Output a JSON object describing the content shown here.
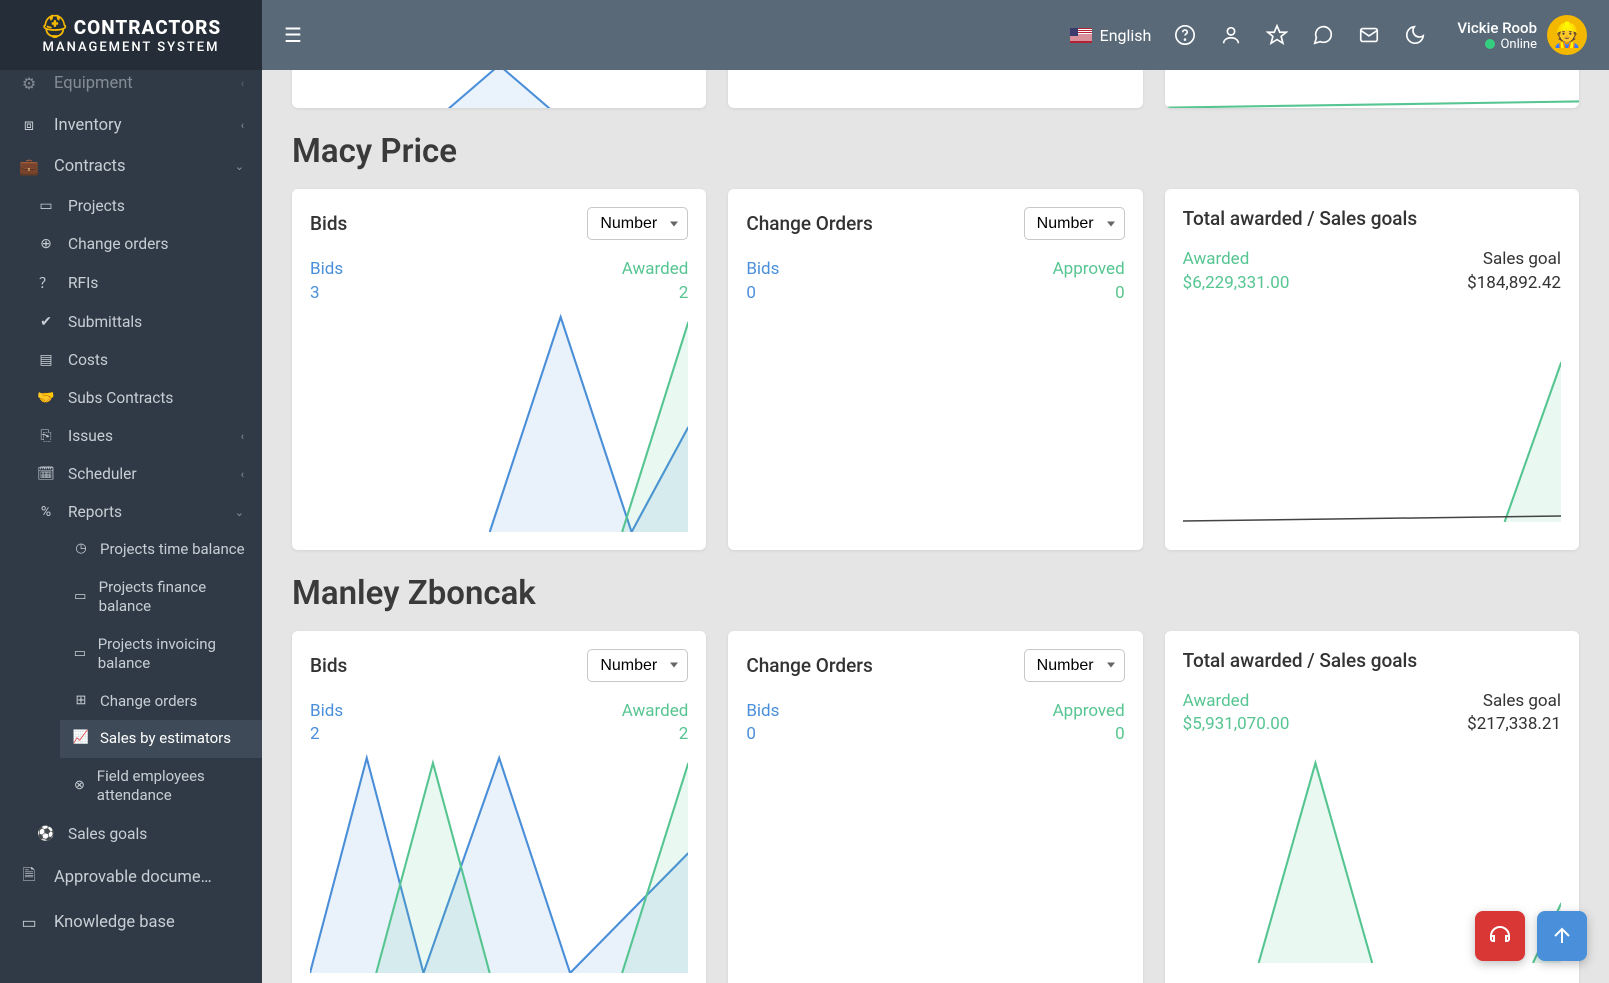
{
  "logo": {
    "top": "CONTRACTORS",
    "sub": "MANAGEMENT SYSTEM"
  },
  "header": {
    "language": "English",
    "user_name": "Vickie Roob",
    "user_status": "Online"
  },
  "sidebar": {
    "items": [
      {
        "label": "Equipment"
      },
      {
        "label": "Inventory"
      },
      {
        "label": "Contracts"
      }
    ],
    "contracts_sub": [
      {
        "label": "Projects"
      },
      {
        "label": "Change orders"
      },
      {
        "label": "RFIs"
      },
      {
        "label": "Submittals"
      },
      {
        "label": "Costs"
      },
      {
        "label": "Subs Contracts"
      },
      {
        "label": "Issues"
      },
      {
        "label": "Scheduler"
      },
      {
        "label": "Reports"
      }
    ],
    "reports_sub": [
      {
        "label": "Projects time balance"
      },
      {
        "label": "Projects finance balance"
      },
      {
        "label": "Projects invoicing balance"
      },
      {
        "label": "Change orders"
      },
      {
        "label": "Sales by estimators"
      },
      {
        "label": "Field employees attendance"
      }
    ],
    "after": [
      {
        "label": "Sales goals"
      },
      {
        "label": "Approvable docume…"
      },
      {
        "label": "Knowledge base"
      }
    ]
  },
  "sections": [
    {
      "name": "Macy Price",
      "bids": {
        "title": "Bids",
        "select": "Number",
        "left_label": "Bids",
        "left_val": "3",
        "right_label": "Awarded",
        "right_val": "2"
      },
      "co": {
        "title": "Change Orders",
        "select": "Number",
        "left_label": "Bids",
        "left_val": "0",
        "right_label": "Approved",
        "right_val": "0"
      },
      "total": {
        "title": "Total awarded / Sales goals",
        "left_label": "Awarded",
        "left_val": "$6,229,331.00",
        "right_label": "Sales goal",
        "right_val": "$184,892.42"
      }
    },
    {
      "name": "Manley Zboncak",
      "bids": {
        "title": "Bids",
        "select": "Number",
        "left_label": "Bids",
        "left_val": "2",
        "right_label": "Awarded",
        "right_val": "2"
      },
      "co": {
        "title": "Change Orders",
        "select": "Number",
        "left_label": "Bids",
        "left_val": "0",
        "right_label": "Approved",
        "right_val": "0"
      },
      "total": {
        "title": "Total awarded / Sales goals",
        "left_label": "Awarded",
        "left_val": "$5,931,070.00",
        "right_label": "Sales goal",
        "right_val": "$217,338.21"
      }
    }
  ],
  "chart_data": [
    {
      "owner": "Macy Price",
      "cards": [
        {
          "type": "area",
          "title": "Bids",
          "series": [
            {
              "name": "Bids",
              "color": "#4a8fd9",
              "values": [
                0,
                0,
                3,
                0,
                1
              ]
            },
            {
              "name": "Awarded",
              "color": "#56c591",
              "values": [
                0,
                0,
                0,
                0,
                2
              ]
            }
          ],
          "ylim": [
            0,
            3
          ]
        },
        {
          "type": "area",
          "title": "Change Orders",
          "series": [
            {
              "name": "Bids",
              "color": "#4a8fd9",
              "values": [
                0,
                0,
                0,
                0,
                0
              ]
            },
            {
              "name": "Approved",
              "color": "#56c591",
              "values": [
                0,
                0,
                0,
                0,
                0
              ]
            }
          ],
          "ylim": [
            0,
            1
          ]
        },
        {
          "type": "area",
          "title": "Total awarded / Sales goals",
          "series": [
            {
              "name": "Awarded",
              "color": "#56c591",
              "values": [
                0,
                0,
                0,
                0,
                6229331
              ]
            },
            {
              "name": "Sales goal",
              "color": "#333",
              "values": [
                0,
                0,
                0,
                0,
                184892
              ]
            }
          ],
          "ylim": [
            0,
            6500000
          ]
        }
      ]
    },
    {
      "owner": "Manley Zboncak",
      "cards": [
        {
          "type": "area",
          "title": "Bids",
          "series": [
            {
              "name": "Bids",
              "color": "#4a8fd9",
              "values": [
                0,
                2,
                0,
                2,
                0,
                1
              ]
            },
            {
              "name": "Awarded",
              "color": "#56c591",
              "values": [
                0,
                0,
                2,
                0,
                0,
                2
              ]
            }
          ],
          "ylim": [
            0,
            2
          ]
        },
        {
          "type": "area",
          "title": "Change Orders",
          "series": [
            {
              "name": "Bids",
              "color": "#4a8fd9",
              "values": [
                0,
                0,
                0,
                0,
                0
              ]
            },
            {
              "name": "Approved",
              "color": "#56c591",
              "values": [
                0,
                0,
                0,
                0,
                0
              ]
            }
          ],
          "ylim": [
            0,
            1
          ]
        },
        {
          "type": "area",
          "title": "Total awarded / Sales goals",
          "series": [
            {
              "name": "Awarded",
              "color": "#56c591",
              "values": [
                0,
                0,
                5900000,
                0,
                0,
                1200000
              ]
            },
            {
              "name": "Sales goal",
              "color": "#333",
              "values": [
                0,
                0,
                0,
                0,
                0,
                217338
              ]
            }
          ],
          "ylim": [
            0,
            6000000
          ]
        }
      ]
    }
  ]
}
